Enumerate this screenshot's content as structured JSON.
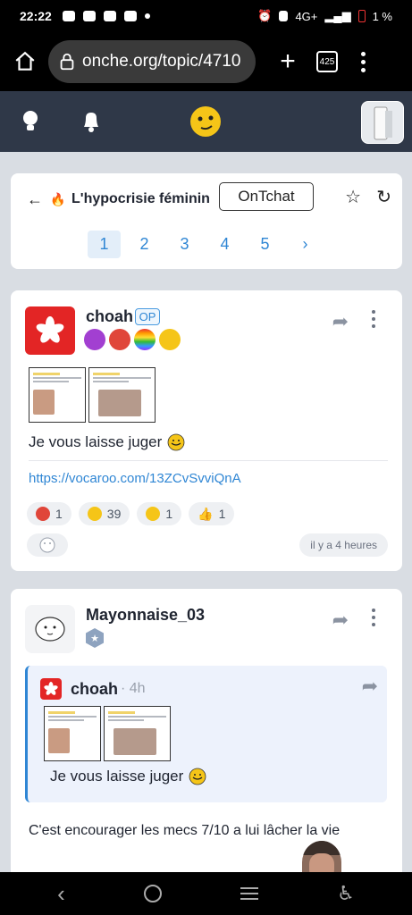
{
  "status": {
    "time": "22:22",
    "network": "4G+",
    "battery": "1 %"
  },
  "browser": {
    "url": "onche.org/topic/4710",
    "tab_count": "425"
  },
  "topic": {
    "title": "L'hypocrisie féminin",
    "ontchat_label": "OnTchat",
    "pages": [
      "1",
      "2",
      "3",
      "4",
      "5"
    ],
    "active_page": "1",
    "next_symbol": "›"
  },
  "post1": {
    "author": "choah",
    "op_label": "OP",
    "text": "Je vous laisse juger",
    "link": "https://vocaroo.com/13ZCvSvviQnA",
    "reactions": [
      {
        "icon": "angry-emoji-icon",
        "count": "1"
      },
      {
        "icon": "laugh-emoji-icon",
        "count": "39"
      },
      {
        "icon": "surprised-emoji-icon",
        "count": "1"
      },
      {
        "icon": "thumbs-up-icon",
        "count": "1"
      }
    ],
    "time": "il y a 4 heures"
  },
  "post2": {
    "author": "Mayonnaise_03",
    "quote": {
      "author": "choah",
      "time": "· 4h",
      "text": "Je vous laisse juger"
    },
    "text": "C'est encourager les mecs 7/10 a lui lâcher la vie"
  },
  "colors": {
    "header": "#2f3848",
    "link": "#2f86d4",
    "flag_red": "#e32525"
  }
}
